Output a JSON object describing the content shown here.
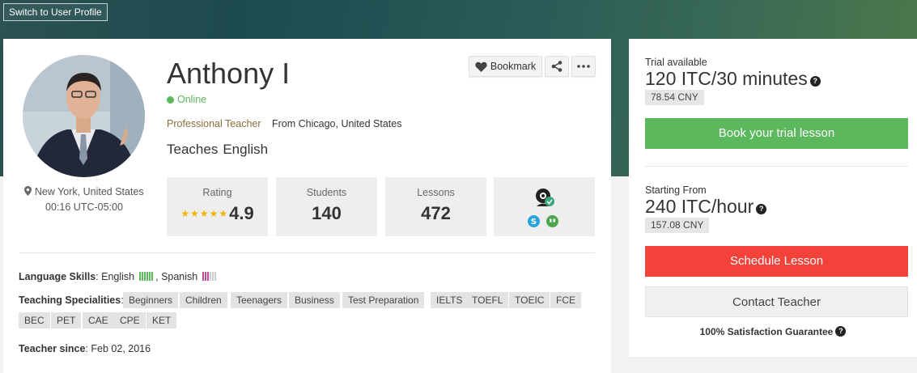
{
  "header": {
    "switch_label": "Switch to User Profile"
  },
  "profile": {
    "name": "Anthony I",
    "status": "Online",
    "professional": "Professional Teacher",
    "from": "From Chicago, United States",
    "teaches_label": "Teaches",
    "teaches_lang": "English",
    "location": "New York, United States",
    "local_time": "00:16 UTC-05:00"
  },
  "actions": {
    "bookmark_label": "Bookmark",
    "share_icon": "share-icon",
    "more_icon": "more-icon"
  },
  "stats": {
    "rating_label": "Rating",
    "rating_value": "4.9",
    "rating_stars": 5,
    "students_label": "Students",
    "students_value": "140",
    "lessons_label": "Lessons",
    "lessons_value": "472"
  },
  "details": {
    "language_label": "Language Skills",
    "languages": [
      {
        "name": "English",
        "level": 6,
        "color": "#5cb85c"
      },
      {
        "name": "Spanish",
        "level": 3,
        "color": "#c0499b"
      }
    ],
    "language_sep": ",",
    "specialities_label": "Teaching Specialities",
    "specialities": [
      "Beginners",
      "Children",
      "Teenagers",
      "Business",
      "Test Preparation",
      "IELTS",
      "TOEFL",
      "TOEIC",
      "FCE",
      "BEC",
      "PET",
      "CAE",
      "CPE",
      "KET"
    ],
    "since_label": "Teacher since",
    "since_value": "Feb 02, 2016"
  },
  "pricing": {
    "trial_label": "Trial available",
    "trial_price": "120 ITC/30 minutes",
    "trial_cny": "78.54 CNY",
    "book_trial_label": "Book your trial lesson",
    "starting_label": "Starting From",
    "hour_price": "240 ITC/hour",
    "hour_cny": "157.08 CNY",
    "schedule_label": "Schedule Lesson",
    "contact_label": "Contact Teacher",
    "guarantee": "100% Satisfaction Guarantee"
  },
  "colors": {
    "primary_green": "#5cb85c",
    "schedule_red": "#f2423a",
    "star": "#f0b400",
    "bar_empty": "#cccccc"
  }
}
